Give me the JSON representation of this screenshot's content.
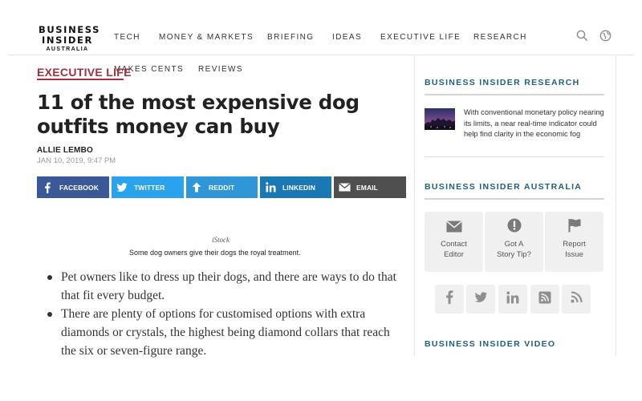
{
  "header": {
    "logo": {
      "line1": "BUSINESS",
      "line2": "INSIDER",
      "line3": "AUSTRALIA"
    },
    "nav": [
      "TECH",
      "MONEY & MARKETS",
      "BRIEFING",
      "IDEAS",
      "EXECUTIVE LIFE",
      "RESEARCH"
    ],
    "icons": [
      "search-icon",
      "globe-icon"
    ]
  },
  "subnav": {
    "section": "EXECUTIVE LIFE",
    "items": [
      "MAKES CENTS",
      "REVIEWS"
    ],
    "accent_color": "#a3303f"
  },
  "article": {
    "headline": "11 of the most expensive dog outfits money can buy",
    "author": "ALLIE LEMBO",
    "date": "JAN 10, 2019, 9:47 PM",
    "share_buttons": [
      {
        "label": "FACEBOOK",
        "icon": "facebook-icon",
        "color": "#3b5998"
      },
      {
        "label": "TWITTER",
        "icon": "twitter-icon",
        "color": "#2aa3ef"
      },
      {
        "label": "REDDIT",
        "icon": "arrow-up-icon",
        "color": "#2f97d8"
      },
      {
        "label": "LINKEDIN",
        "icon": "linkedin-icon",
        "color": "#1a78b5"
      },
      {
        "label": "EMAIL",
        "icon": "email-icon",
        "color": "#4f4f4f"
      }
    ],
    "image_credit": "iStock",
    "image_caption": "Some dog owners give their dogs the royal treatment.",
    "bullets": [
      "Pet owners like to dress up their dogs, and there are ways to do that that fit every budget.",
      "There are plenty of options for customised options with extra diamonds or crystals, the highest being diamond collars that reach the six or seven-figure range."
    ]
  },
  "sidebar": {
    "research": {
      "heading": "BUSINESS INSIDER RESEARCH",
      "story": "With conventional monetary policy nearing its limits, a near real-time indicator could help find clarity in the economic fog"
    },
    "australia": {
      "heading": "BUSINESS INSIDER AUSTRALIA",
      "tiles": [
        {
          "line1": "Contact",
          "line2": "Editor",
          "icon": "envelope-icon"
        },
        {
          "line1": "Got A",
          "line2": "Story Tip?",
          "icon": "alert-icon"
        },
        {
          "line1": "Report",
          "line2": "Issue",
          "icon": "flag-icon"
        }
      ],
      "social": [
        "facebook-icon",
        "twitter-icon",
        "linkedin-icon",
        "rss-feed-icon",
        "rss-icon"
      ]
    },
    "video": {
      "heading": "BUSINESS INSIDER VIDEO"
    },
    "heading_color": "#1f5f7f"
  }
}
